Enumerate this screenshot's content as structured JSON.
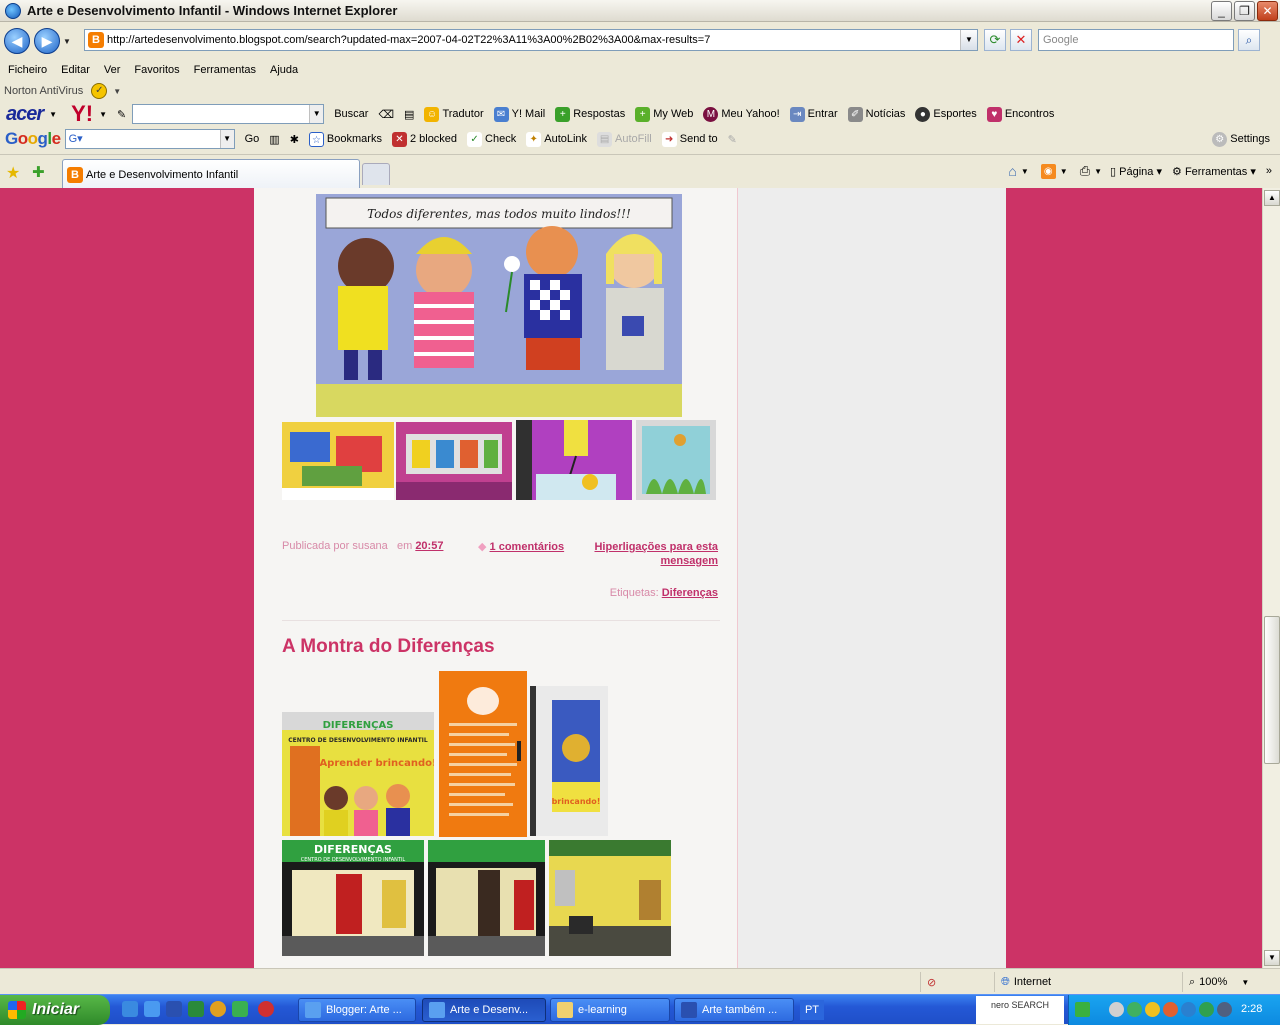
{
  "window": {
    "title": "Arte e Desenvolvimento Infantil - Windows Internet Explorer"
  },
  "address": {
    "url": "http://artedesenvolvimento.blogspot.com/search?updated-max=2007-04-02T22%3A11%3A00%2B02%3A00&max-results=7"
  },
  "search": {
    "placeholder": "Google"
  },
  "menu": [
    "Ficheiro",
    "Editar",
    "Ver",
    "Favoritos",
    "Ferramentas",
    "Ajuda"
  ],
  "norton": {
    "label": "Norton AntiVirus"
  },
  "toolbar1": {
    "acer": "acer",
    "yahoo": "Y!",
    "buscar": "Buscar",
    "tradutor": "Tradutor",
    "mail": "Y! Mail",
    "respostas": "Respostas",
    "myweb": "My Web",
    "meuyahoo": "Meu Yahoo!",
    "entrar": "Entrar",
    "noticias": "Notícias",
    "esportes": "Esportes",
    "encontros": "Encontros"
  },
  "toolbar2": {
    "google": "Google",
    "go": "Go",
    "bookmarks": "Bookmarks",
    "blocked": "2 blocked",
    "check": "Check",
    "autolink": "AutoLink",
    "autofill": "AutoFill",
    "sendto": "Send to",
    "settings": "Settings"
  },
  "tab": {
    "label": "Arte e Desenvolvimento Infantil"
  },
  "commandbar": {
    "pagina": "Página",
    "ferramentas": "Ferramentas"
  },
  "post1": {
    "banner_text": "Todos diferentes, mas todos muito lindos!!!",
    "published_by": "Publicada por susana",
    "at": "em",
    "time": "20:57",
    "comments": "1 comentários",
    "links": "Hiperligações para esta mensagem",
    "labels_prefix": "Etiquetas:",
    "label": "Diferenças"
  },
  "post2": {
    "title": "A Montra do Diferenças",
    "sign1_line1": "DIFERENÇAS",
    "sign1_line2": "CENTRO DE DESENVOLVIMENTO INFANTIL",
    "sign1_line3": "Aprender brincando!",
    "poster_text": "brincando!",
    "sign2": "DIFERENÇAS",
    "sign2_sub": "CENTRO DE DESENVOLVIMENTO INFANTIL"
  },
  "status": {
    "zone": "Internet",
    "zoom": "100%"
  },
  "taskbar": {
    "start": "Iniciar",
    "tasks": [
      "Blogger: Arte ...",
      "Arte e Desenv...",
      "e-learning",
      "Arte também ..."
    ],
    "lang": "PT",
    "nero": "nero SEARCH",
    "clock": "2:28"
  },
  "colors": {
    "page_bg": "#cc3366",
    "title_pink": "#cc3366",
    "link_pink": "#c0306a"
  }
}
